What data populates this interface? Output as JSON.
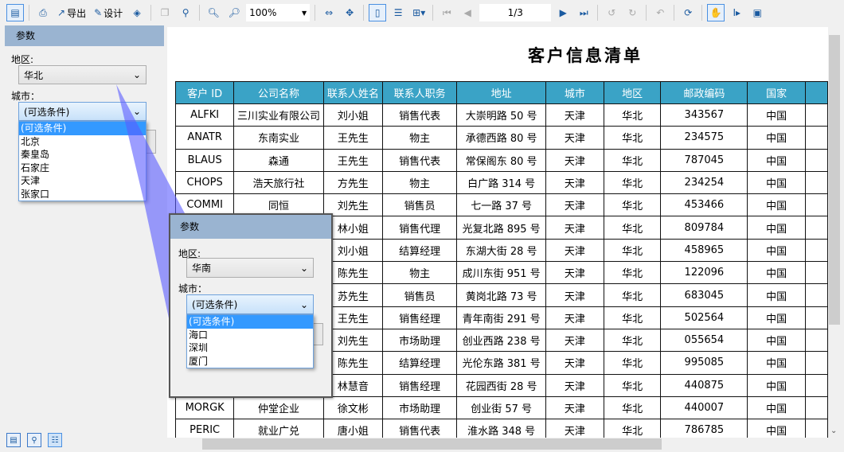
{
  "toolbar": {
    "export_label": "导出",
    "design_label": "设计",
    "zoom_value": "100%",
    "page_indicator": "1/3",
    "icons": [
      "page-setup-icon",
      "print-icon",
      "export-icon",
      "design-icon",
      "eraser-icon",
      "copy-icon",
      "find-icon",
      "zoom-in-icon",
      "zoom-out-icon",
      "fit-width-icon",
      "fit-page-icon",
      "single-page-icon",
      "continuous-page-icon",
      "multi-page-icon",
      "first-page-icon",
      "prev-page-icon",
      "next-page-icon",
      "last-page-icon",
      "undo-icon",
      "redo-icon",
      "back-icon",
      "refresh-icon",
      "hand-tool-icon",
      "text-select-icon",
      "snapshot-icon"
    ]
  },
  "left_panel": {
    "header": "参数",
    "region_label": "地区:",
    "region_value": "华北",
    "city_label": "城市：",
    "city_value": "(可选条件)",
    "city_options": [
      "(可选条件)",
      "北京",
      "秦皇岛",
      "石家庄",
      "天津",
      "张家口"
    ]
  },
  "popup": {
    "header": "参数",
    "region_label": "地区:",
    "region_value": "华南",
    "city_label": "城市：",
    "city_value": "(可选条件)",
    "city_options": [
      "(可选条件)",
      "海口",
      "深圳",
      "厦门"
    ]
  },
  "report": {
    "title": "客户信息清单",
    "columns": [
      "客户 ID",
      "公司名称",
      "联系人姓名",
      "联系人职务",
      "地址",
      "城市",
      "地区",
      "邮政编码",
      "国家"
    ],
    "rows": [
      [
        "ALFKI",
        "三川实业有限公司",
        "刘小姐",
        "销售代表",
        "大崇明路 50 号",
        "天津",
        "华北",
        "343567",
        "中国"
      ],
      [
        "ANATR",
        "东南实业",
        "王先生",
        "物主",
        "承德西路 80 号",
        "天津",
        "华北",
        "234575",
        "中国"
      ],
      [
        "BLAUS",
        "森通",
        "王先生",
        "销售代表",
        "常保阁东 80 号",
        "天津",
        "华北",
        "787045",
        "中国"
      ],
      [
        "CHOPS",
        "浩天旅行社",
        "方先生",
        "物主",
        "白广路 314 号",
        "天津",
        "华北",
        "234254",
        "中国"
      ],
      [
        "COMMI",
        "同恒",
        "刘先生",
        "销售员",
        "七一路 37 号",
        "天津",
        "华北",
        "453466",
        "中国"
      ],
      [
        "",
        "",
        "林小姐",
        "销售代理",
        "光复北路 895 号",
        "天津",
        "华北",
        "809784",
        "中国"
      ],
      [
        "",
        "",
        "刘小姐",
        "结算经理",
        "东湖大街 28 号",
        "天津",
        "华北",
        "458965",
        "中国"
      ],
      [
        "",
        "",
        "陈先生",
        "物主",
        "成川东街 951 号",
        "天津",
        "华北",
        "122096",
        "中国"
      ],
      [
        "",
        "",
        "苏先生",
        "销售员",
        "黄岗北路 73 号",
        "天津",
        "华北",
        "683045",
        "中国"
      ],
      [
        "",
        "",
        "王先生",
        "销售经理",
        "青年南街 291 号",
        "天津",
        "华北",
        "502564",
        "中国"
      ],
      [
        "",
        "",
        "刘先生",
        "市场助理",
        "创业西路 238 号",
        "天津",
        "华北",
        "055654",
        "中国"
      ],
      [
        "",
        "",
        "陈先生",
        "结算经理",
        "光伦东路 381 号",
        "天津",
        "华北",
        "995085",
        "中国"
      ],
      [
        "",
        "",
        "林慧音",
        "销售经理",
        "花园西街 28 号",
        "天津",
        "华北",
        "440875",
        "中国"
      ],
      [
        "MORGK",
        "仲堂企业",
        "徐文彬",
        "市场助理",
        "创业街 57 号",
        "天津",
        "华北",
        "440007",
        "中国"
      ],
      [
        "PERIC",
        "就业广兑",
        "唐小姐",
        "销售代表",
        "淮水路 348 号",
        "天津",
        "华北",
        "786785",
        "中国"
      ]
    ]
  },
  "colors": {
    "header_bg": "#3aa3c6",
    "panel_header": "#9ab4d1",
    "highlight": "#3399ff",
    "wedge": "#5a5cff"
  },
  "bottom_icons": [
    "parameters-tab-icon",
    "find-tab-icon",
    "outline-tab-icon"
  ]
}
